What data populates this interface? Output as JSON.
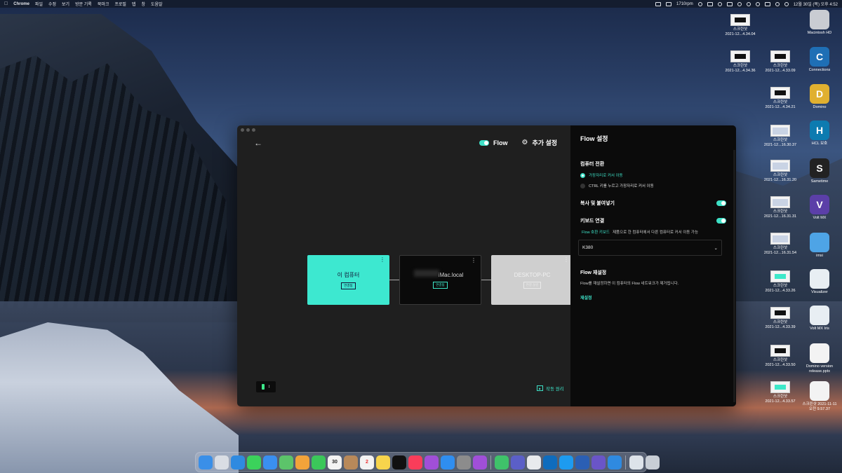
{
  "menubar": {
    "app_name": "Chrome",
    "menus": [
      "파일",
      "수정",
      "보기",
      "방문 기록",
      "북마크",
      "프로필",
      "탭",
      "창",
      "도움말"
    ],
    "rpm": "1710rpm",
    "datetime": "12월 30일 (목) 오후 4:52"
  },
  "desktop": {
    "col1": [
      {
        "label": "스크린샷\n2021-12...4.34.04",
        "kind": "shot"
      },
      {
        "label": "스크린샷\n2021-12...4.34.36",
        "kind": "shot"
      }
    ],
    "col2": [
      {
        "label": "스크린샷\n2021-12...4.33.09",
        "kind": "shot"
      },
      {
        "label": "스크린샷\n2021-12...4.34.21",
        "kind": "shot"
      },
      {
        "label": "스크린샷\n2021-12...16.30.37",
        "kind": "doc"
      },
      {
        "label": "스크린샷\n2021-12...16.31.20",
        "kind": "doc"
      },
      {
        "label": "스크린샷\n2021-12...16.31.31",
        "kind": "doc"
      },
      {
        "label": "스크린샷\n2021-12...16.31.54",
        "kind": "doc"
      },
      {
        "label": "스크린샷\n2021-12...4.33.26",
        "kind": "teal"
      },
      {
        "label": "스크린샷\n2021-12...4.33.39",
        "kind": "shot"
      },
      {
        "label": "스크린샷\n2021-12...4.33.50",
        "kind": "shot"
      },
      {
        "label": "스크린샷\n2021-12...4.33.57",
        "kind": "teal"
      }
    ],
    "col3": [
      {
        "label": "Macintosh HD",
        "color": "#c9ccd2",
        "glyph": ""
      },
      {
        "label": "Connections",
        "color": "#1f6fb5",
        "glyph": "C"
      },
      {
        "label": "Domino",
        "color": "#e0b030",
        "glyph": "D"
      },
      {
        "label": "HCL 보호",
        "color": "#0d7bb0",
        "glyph": "H"
      },
      {
        "label": "Sametime",
        "color": "#222222",
        "glyph": "S"
      },
      {
        "label": "Volt MX",
        "color": "#5b3fa8",
        "glyph": "V"
      },
      {
        "label": "imsi",
        "color": "#4ea4e6",
        "glyph": ""
      },
      {
        "label": "Visualizer",
        "color": "#e8eef3",
        "glyph": ""
      },
      {
        "label": "Volt MX Iris",
        "color": "#e8eef3",
        "glyph": ""
      },
      {
        "label": "Domino version\nrelease.pptx",
        "color": "#f3f3f3",
        "glyph": ""
      },
      {
        "label": "스크린샷 2021-11-11\n오전 9.57.37",
        "color": "#f3f3f3",
        "glyph": ""
      }
    ]
  },
  "window": {
    "flow_label": "Flow",
    "settings_label": "추가 설정",
    "computers": [
      {
        "name": "이 컴퓨터",
        "status": "연결됨"
      },
      {
        "name": "iMac.local",
        "status": "연결됨"
      },
      {
        "name": "DESKTOP-PC",
        "status": "연결 끊김"
      }
    ],
    "how_it_works": "작동 원리"
  },
  "panel": {
    "title": "Flow 설정",
    "switch_title": "컴퓨터 전환",
    "option_edge": "가장자리로 커서 이동",
    "option_ctrl": "CTRL 키를 누르고 가장자리로 커서 이동",
    "copy_paste": "복사 및 붙여넣기",
    "keyboard_link": "키보드 연결",
    "kb_highlight": "Flow 호환 키보드",
    "kb_desc": "제품으로 한 컴퓨터에서 다른 컴퓨터로 커서 이동 가능",
    "keyboard_model": "K380",
    "reset_title": "Flow 재설정",
    "reset_desc": "Flow를 재설정하면 이 컴퓨터의 Flow 네트워크가 제거됩니다.",
    "reset_link": "재설정"
  },
  "dock": {
    "apps": [
      {
        "name": "Finder",
        "color": "#3a8fe8"
      },
      {
        "name": "Launchpad",
        "color": "#d9dde4"
      },
      {
        "name": "Safari",
        "color": "#2f8ae0"
      },
      {
        "name": "Messages",
        "color": "#3bd25b"
      },
      {
        "name": "Mail",
        "color": "#3a8ff0"
      },
      {
        "name": "Maps",
        "color": "#5cc46a"
      },
      {
        "name": "Photos",
        "color": "#f2a33a"
      },
      {
        "name": "FaceTime",
        "color": "#3bc75a"
      },
      {
        "name": "Calendar",
        "color": "#f3f3f3"
      },
      {
        "name": "Contacts",
        "color": "#b8895a"
      },
      {
        "name": "Reminders",
        "color": "#f3f3f3"
      },
      {
        "name": "Notes",
        "color": "#f7d44c"
      },
      {
        "name": "TV",
        "color": "#111111"
      },
      {
        "name": "Music",
        "color": "#fa3d5a"
      },
      {
        "name": "Podcasts",
        "color": "#a04fd8"
      },
      {
        "name": "App Store",
        "color": "#2f8ef0"
      },
      {
        "name": "System Preferences",
        "color": "#8c8c8c"
      },
      {
        "name": "Feedback",
        "color": "#a04fd8"
      }
    ],
    "apps2": [
      {
        "name": "Connections",
        "color": "#3fc26a"
      },
      {
        "name": "Teams",
        "color": "#5b5fc7"
      },
      {
        "name": "Chrome",
        "color": "#e8eaed"
      },
      {
        "name": "Outlook",
        "color": "#0f6cbd"
      },
      {
        "name": "Twitter",
        "color": "#1d9bf0"
      },
      {
        "name": "Word",
        "color": "#2b5fb4"
      },
      {
        "name": "HCL",
        "color": "#6a55c8"
      },
      {
        "name": "Safari2",
        "color": "#2f8ae0"
      }
    ],
    "calendar_day": "30",
    "reminders_badge": "2"
  }
}
